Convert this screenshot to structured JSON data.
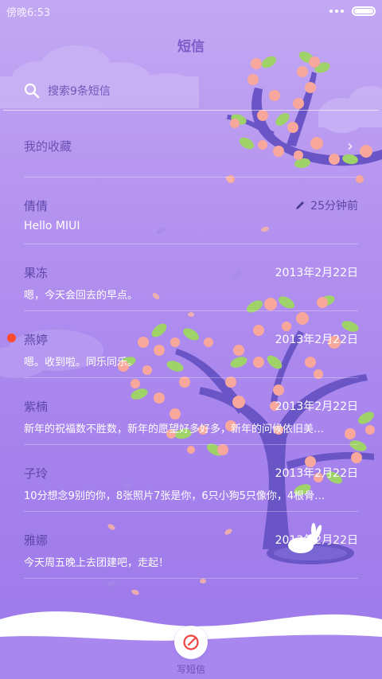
{
  "status_bar": {
    "time": "傍晚6:53",
    "battery_level": 1.0
  },
  "header": {
    "title": "短信"
  },
  "search": {
    "placeholder": "搜索9条短信"
  },
  "favorites": {
    "label": "我的收藏"
  },
  "conversations": [
    {
      "name": "倩倩",
      "time": "25分钟前",
      "preview": "Hello MIUI",
      "draft": true,
      "unread": false
    },
    {
      "name": "果冻",
      "time": "2013年2月22日",
      "preview": "嗯，今天会回去的早点。",
      "draft": false,
      "unread": false
    },
    {
      "name": "燕婷",
      "time": "2013年2月22日",
      "preview": "嗯。收到啦。同乐同乐。",
      "draft": false,
      "unread": true
    },
    {
      "name": "紫楠",
      "time": "2013年2月22日",
      "preview": "新年的祝福数不胜数，新年的愿望好多好多，新年的问候依旧美…",
      "draft": false,
      "unread": false
    },
    {
      "name": "子玲",
      "time": "2013年2月22日",
      "preview": "10分想念9别的你，8张照片7张是你，6只小狗5只像你，4根骨…",
      "draft": false,
      "unread": false
    },
    {
      "name": "雅娜",
      "time": "2013年2月22日",
      "preview": "今天周五晚上去团建吧，走起！",
      "draft": false,
      "unread": false
    }
  ],
  "compose": {
    "label": "写短信"
  },
  "colors": {
    "accent": "#7e5cc9",
    "unread": "#ff4a2e",
    "background": "#b391ef"
  }
}
